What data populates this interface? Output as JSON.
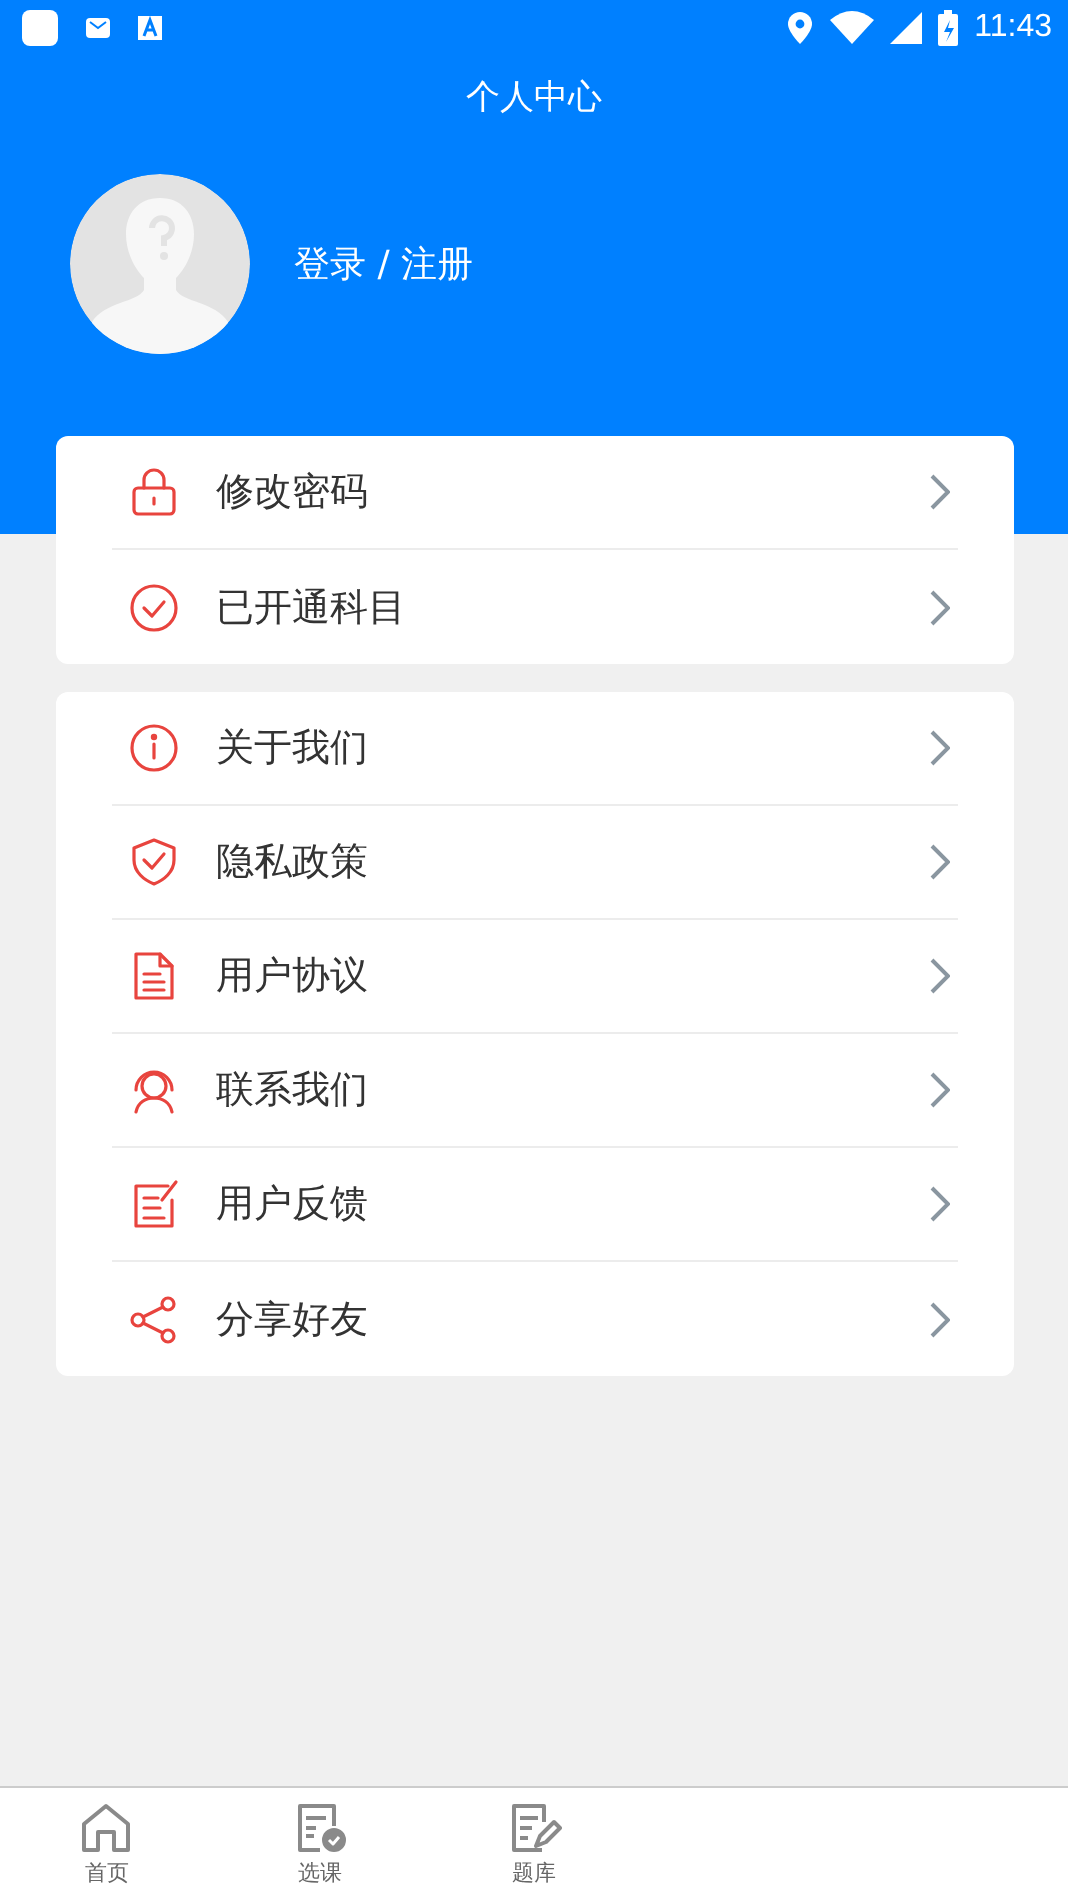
{
  "status_bar": {
    "time": "11:43"
  },
  "header": {
    "title": "个人中心",
    "login_label": "登录 / 注册"
  },
  "menu_groups": [
    {
      "items": [
        {
          "label": "修改密码",
          "kind": "lock"
        },
        {
          "label": "已开通科目",
          "kind": "check"
        }
      ]
    },
    {
      "items": [
        {
          "label": "关于我们",
          "kind": "info"
        },
        {
          "label": "隐私政策",
          "kind": "shield"
        },
        {
          "label": "用户协议",
          "kind": "document"
        },
        {
          "label": "联系我们",
          "kind": "person"
        },
        {
          "label": "用户反馈",
          "kind": "feedback"
        },
        {
          "label": "分享好友",
          "kind": "share"
        }
      ]
    }
  ],
  "tab_bar": [
    {
      "label": "首页",
      "kind": "home",
      "selected": false
    },
    {
      "label": "选课",
      "kind": "course",
      "selected": false
    },
    {
      "label": "题库",
      "kind": "quiz",
      "selected": false
    }
  ]
}
